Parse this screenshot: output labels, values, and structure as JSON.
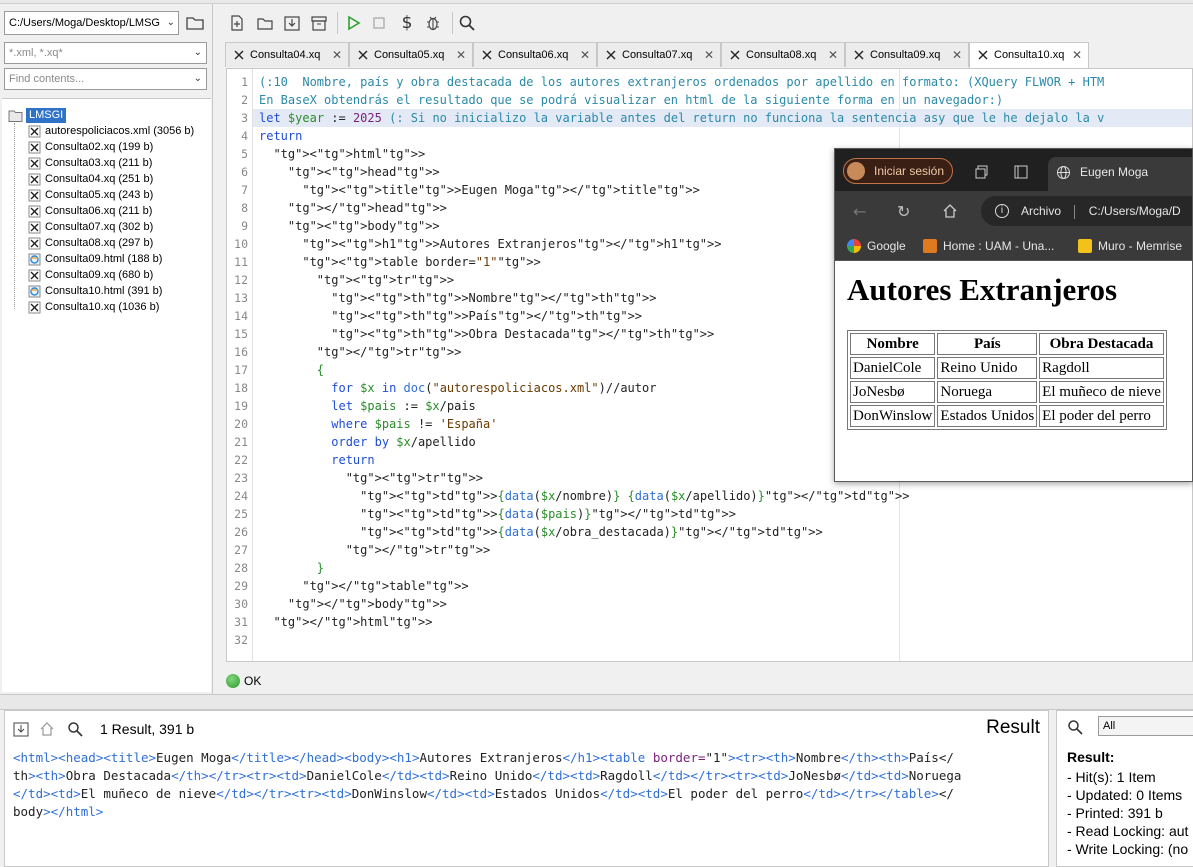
{
  "left": {
    "path": "C:/Users/Moga/Desktop/LMSG",
    "filter_files_placeholder": "*.xml, *.xq*",
    "filter_contents_placeholder": "Find contents...",
    "root": "LMSGI",
    "files": [
      {
        "name": "autorespoliciacos.xml (3056 b)",
        "type": "xml"
      },
      {
        "name": "Consulta02.xq (199 b)",
        "type": "xq"
      },
      {
        "name": "Consulta03.xq (211 b)",
        "type": "xq"
      },
      {
        "name": "Consulta04.xq (251 b)",
        "type": "xq"
      },
      {
        "name": "Consulta05.xq (243 b)",
        "type": "xq"
      },
      {
        "name": "Consulta06.xq (211 b)",
        "type": "xq"
      },
      {
        "name": "Consulta07.xq (302 b)",
        "type": "xq"
      },
      {
        "name": "Consulta08.xq (297 b)",
        "type": "xq"
      },
      {
        "name": "Consulta09.html (188 b)",
        "type": "html"
      },
      {
        "name": "Consulta09.xq (680 b)",
        "type": "xq"
      },
      {
        "name": "Consulta10.html (391 b)",
        "type": "html"
      },
      {
        "name": "Consulta10.xq (1036 b)",
        "type": "xq"
      }
    ]
  },
  "toolbar": {
    "icons": [
      "new-file-icon",
      "open-file-icon",
      "save-icon",
      "close-all-icon",
      "run-icon",
      "stop-icon",
      "dollar-icon",
      "debug-icon",
      "search-icon"
    ]
  },
  "tabs": [
    {
      "label": "Consulta04.xq"
    },
    {
      "label": "Consulta05.xq"
    },
    {
      "label": "Consulta06.xq"
    },
    {
      "label": "Consulta07.xq"
    },
    {
      "label": "Consulta08.xq"
    },
    {
      "label": "Consulta09.xq"
    },
    {
      "label": "Consulta10.xq",
      "active": true
    }
  ],
  "editor": {
    "lines": [
      "(:10  Nombre, país y obra destacada de los autores extranjeros ordenados por apellido en formato: (XQuery FLWOR + HTM",
      "En BaseX obtendrás el resultado que se podrá visualizar en html de la siguiente forma en un navegador:)",
      "let $year := 2025 (: Si no inicializo la variable antes del return no funciona la sentencia asy que le he dejalo la v",
      "return",
      "  <html>",
      "    <head>",
      "      <title>Eugen Moga</title>",
      "    </head>",
      "    <body>",
      "      <h1>Autores Extranjeros</h1>",
      "      <table border=\"1\">",
      "        <tr>",
      "          <th>Nombre</th>",
      "          <th>País</th>",
      "          <th>Obra Destacada</th>",
      "        </tr>",
      "        {",
      "          for $x in doc(\"autorespoliciacos.xml\")//autor",
      "          let $pais := $x/pais",
      "          where $pais != 'España'",
      "          order by $x/apellido",
      "          return",
      "            <tr>",
      "              <td>{data($x/nombre)} {data($x/apellido)}</td>",
      "              <td>{data($pais)}</td>",
      "              <td>{data($x/obra_destacada)}</td>",
      "            </tr>",
      "        }",
      "      </table>",
      "    </body>",
      "  </html>",
      ""
    ]
  },
  "status": {
    "text": "OK"
  },
  "browser": {
    "signin": "Iniciar sesión",
    "tab_title": "Eugen Moga",
    "address_label": "Archivo",
    "address": "C:/Users/Moga/D",
    "bookmarks": [
      "Google",
      "Home : UAM - Una...",
      "Muro - Memrise"
    ],
    "h1": "Autores Extranjeros",
    "table_headers": [
      "Nombre",
      "País",
      "Obra Destacada"
    ],
    "table_rows": [
      [
        "DanielCole",
        "Reino Unido",
        "Ragdoll"
      ],
      [
        "JoNesbø",
        "Noruega",
        "El muñeco de nieve"
      ],
      [
        "DonWinslow",
        "Estados Unidos",
        "El poder del perro"
      ]
    ]
  },
  "result": {
    "count": "1 Result, 391 b",
    "title": "Result",
    "lines": [
      "<html><head><title>Eugen Moga</title></head><body><h1>Autores Extranjeros</h1><table border=\"1\"><tr><th>Nombre</th><th>País</",
      "th><th>Obra Destacada</th></tr><tr><td>DanielCole</td><td>Reino Unido</td><td>Ragdoll</td></tr><tr><td>JoNesbø</td><td>Noruega",
      "</td><td>El muñeco de nieve</td></tr><tr><td>DonWinslow</td><td>Estados Unidos</td><td>El poder del perro</td></tr></table></",
      "body></html>"
    ]
  },
  "info": {
    "select": "All",
    "heading": "Result:",
    "lines": [
      "- Hit(s): 1 Item",
      "- Updated: 0 Items",
      "- Printed: 391 b",
      "- Read Locking: aut",
      "- Write Locking: (no"
    ]
  }
}
